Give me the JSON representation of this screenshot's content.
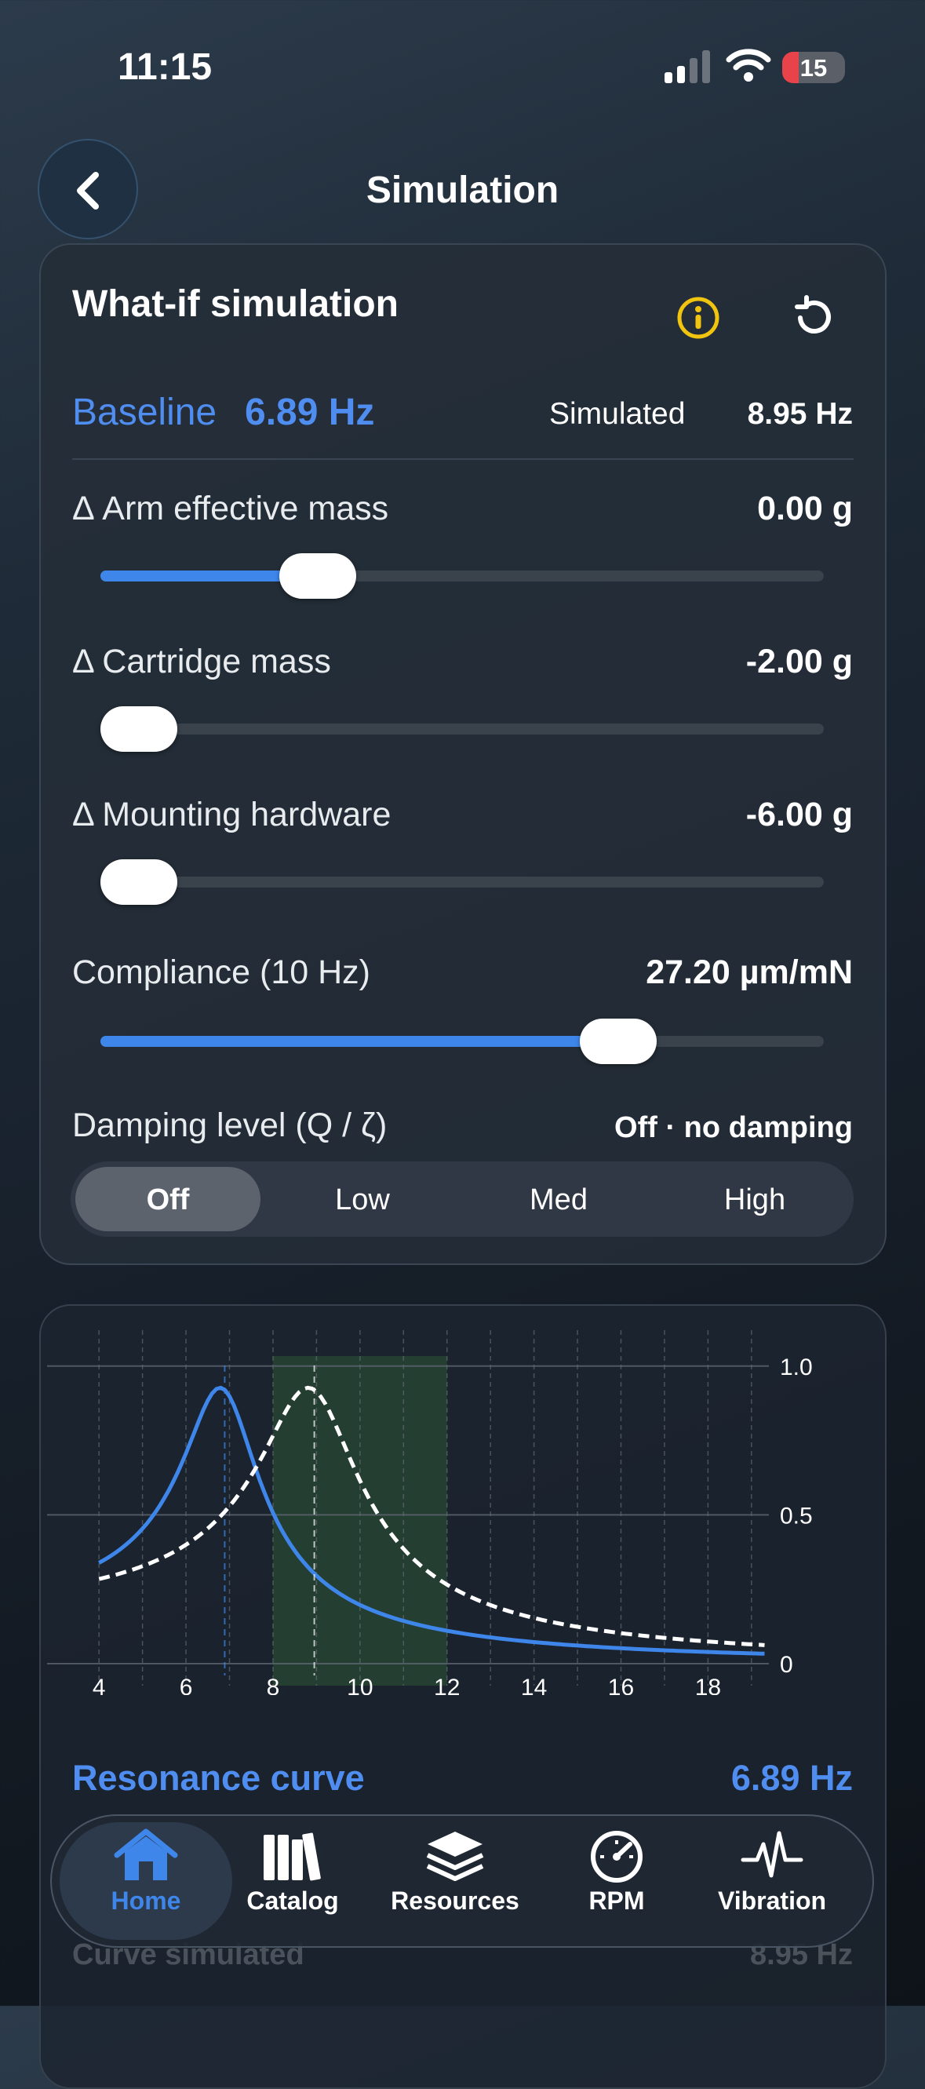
{
  "status": {
    "time": "11:15",
    "battery": "15"
  },
  "header": {
    "title": "Simulation"
  },
  "card": {
    "title": "What-if simulation",
    "baseline_label": "Baseline",
    "baseline_value": "6.89 Hz",
    "simulated_label": "Simulated",
    "simulated_value": "8.95 Hz"
  },
  "sliders": [
    {
      "label": "Δ Arm effective mass",
      "value": "0.00 g",
      "level": 0.25
    },
    {
      "label": "Δ Cartridge mass",
      "value": "-2.00 g",
      "level": 0.0
    },
    {
      "label": "Δ Mounting hardware",
      "value": "-6.00 g",
      "level": 0.0
    },
    {
      "label": "Compliance (10 Hz)",
      "value": "27.20 µm/mN",
      "level": 0.71
    }
  ],
  "damping": {
    "label": "Damping level (Q / ζ)",
    "value": "Off · no damping",
    "options": [
      "Off",
      "Low",
      "Med",
      "High"
    ],
    "selected": "Off"
  },
  "chart_data": {
    "type": "line",
    "x_ticks": [
      "4",
      "6",
      "8",
      "10",
      "12",
      "14",
      "16",
      "18"
    ],
    "y_ticks": [
      "1.0",
      "0.5",
      "0"
    ],
    "xlim": [
      3.6,
      19.4
    ],
    "ylim": [
      0,
      1.0
    ],
    "preferred_zone": [
      8,
      12
    ],
    "series": [
      {
        "style": "solid",
        "color": "#3e86ea",
        "peak_hz": 6.89
      },
      {
        "style": "dashed",
        "color": "#ffffff",
        "peak_hz": 8.95
      }
    ]
  },
  "resonance": {
    "title": "Resonance curve",
    "value": "6.89 Hz",
    "footer_label": "Curve simulated",
    "footer_value": "8.95 Hz"
  },
  "tabs": [
    {
      "label": "Home",
      "icon": "home-icon",
      "active": true
    },
    {
      "label": "Catalog",
      "icon": "books-icon",
      "active": false
    },
    {
      "label": "Resources",
      "icon": "layers-icon",
      "active": false
    },
    {
      "label": "RPM",
      "icon": "gauge-icon",
      "active": false
    },
    {
      "label": "Vibration",
      "icon": "waveform-icon",
      "active": false
    }
  ]
}
